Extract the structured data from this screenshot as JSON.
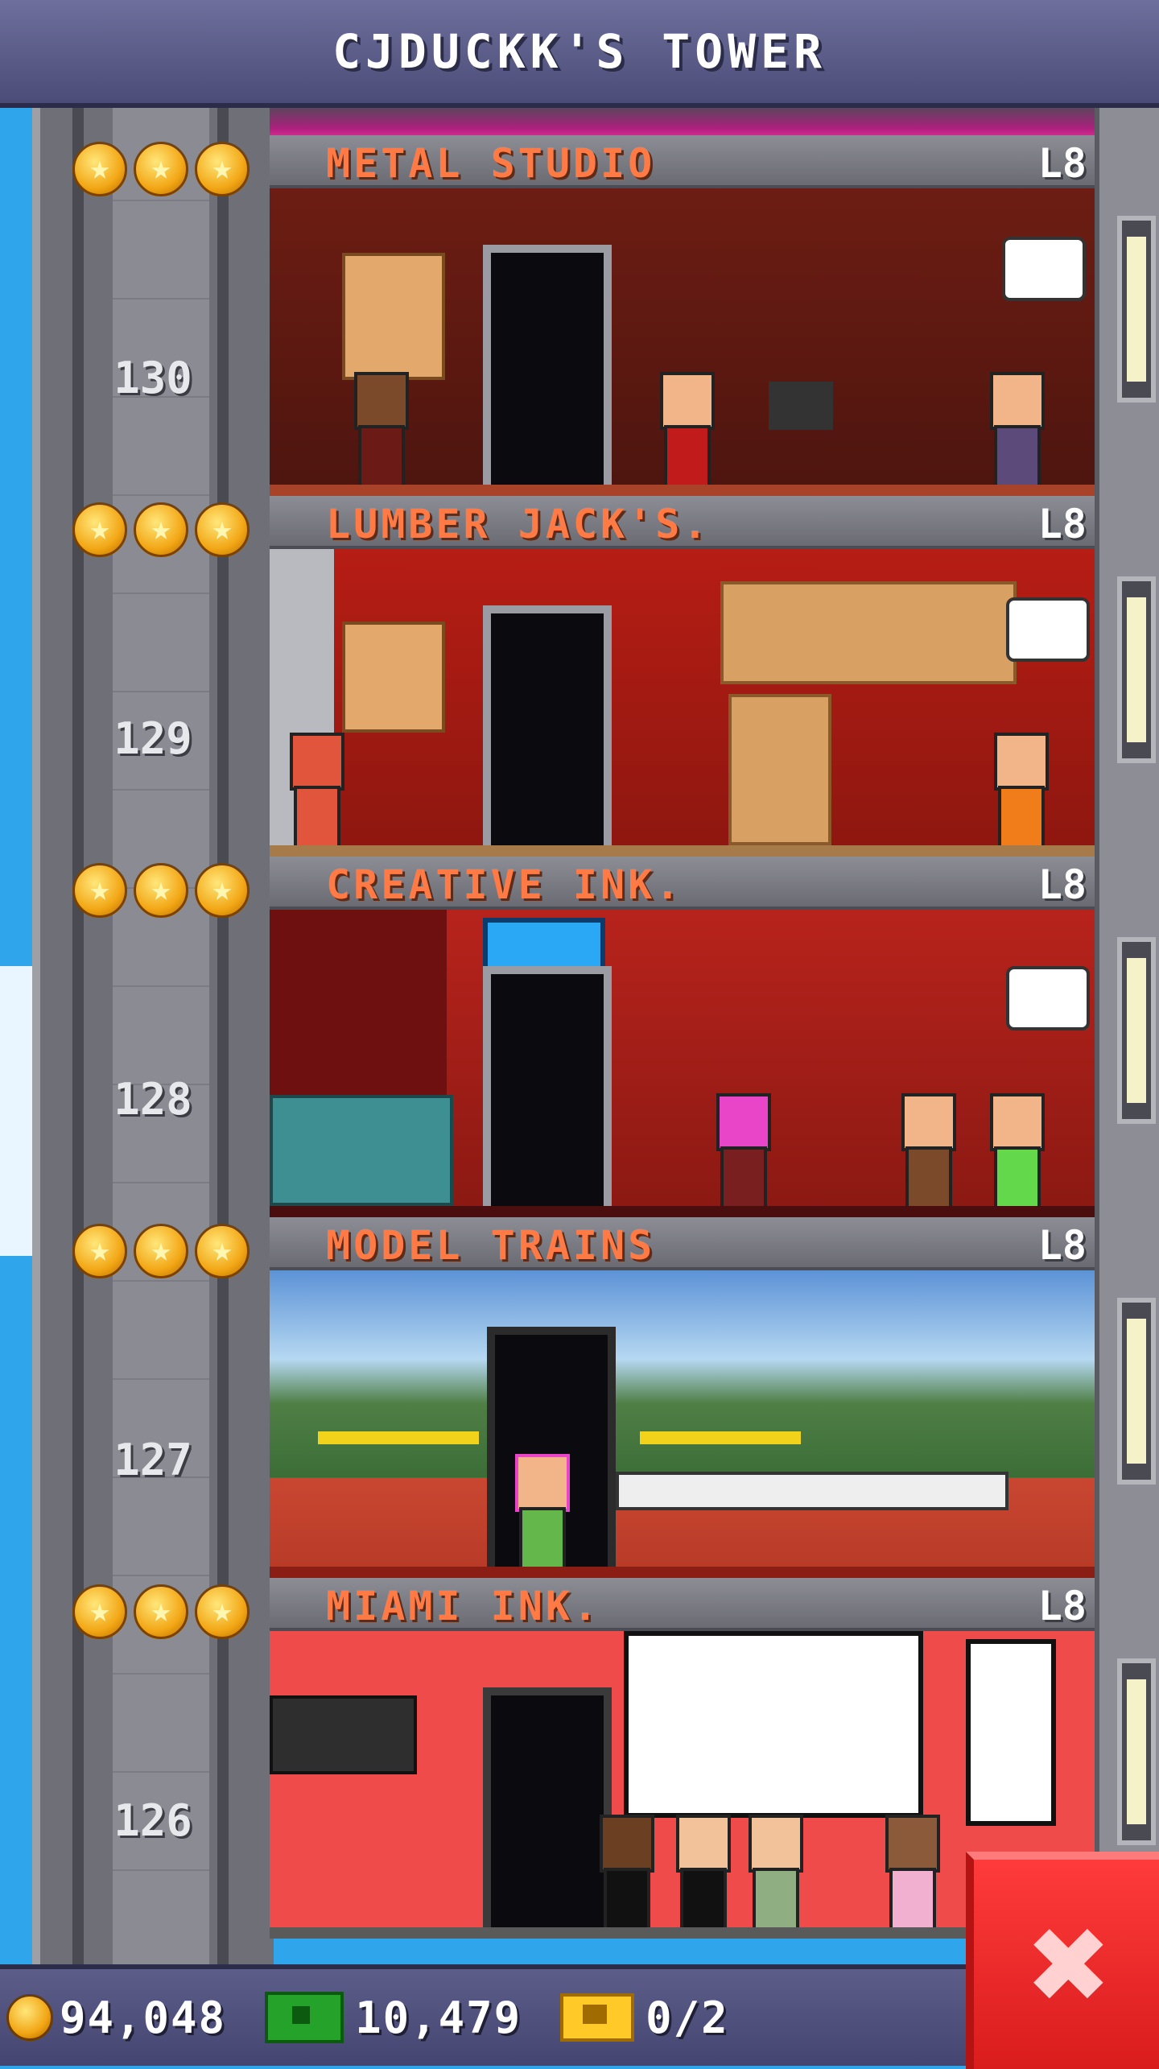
{
  "header": {
    "title": "CJDUCKK'S TOWER"
  },
  "floors": [
    {
      "number": "130",
      "name": "METAL STUDIO",
      "level": "L8",
      "stars": 3
    },
    {
      "number": "129",
      "name": "LUMBER JACK'S.",
      "level": "L8",
      "stars": 3
    },
    {
      "number": "128",
      "name": "CREATIVE INK.",
      "level": "L8",
      "stars": 3
    },
    {
      "number": "127",
      "name": "MODEL TRAINS",
      "level": "L8",
      "stars": 3
    },
    {
      "number": "126",
      "name": "MIAMI INK.",
      "level": "L8",
      "stars": 3
    }
  ],
  "status_bar": {
    "coins": "94,048",
    "bux": "10,479",
    "tickets": "0/2"
  },
  "icons": {
    "coin": "coin-icon",
    "bux": "tower-bux-icon",
    "ticket": "vip-ticket-icon",
    "star": "star-icon",
    "close": "close-icon"
  },
  "colors": {
    "title_bar": "#555683",
    "room_name": "#ff7a45",
    "close_button": "#e52424",
    "sky": "#2fa6ec"
  }
}
